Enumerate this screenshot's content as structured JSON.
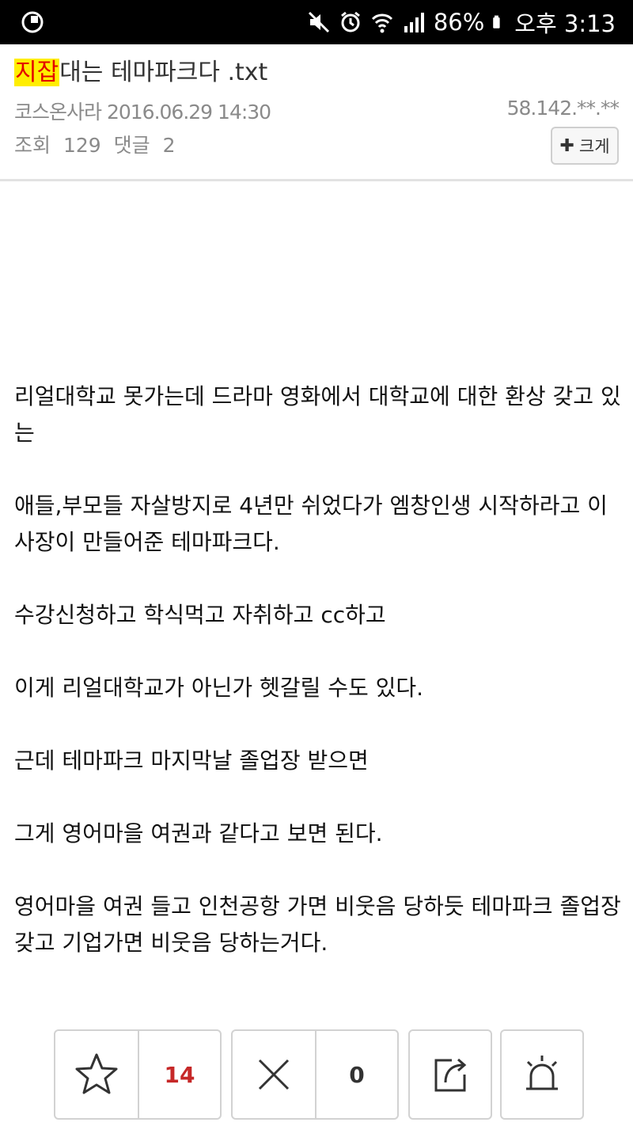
{
  "status_bar": {
    "battery": "86%",
    "time": "오후 3:13"
  },
  "post": {
    "title_highlight": "지잡",
    "title_rest": "대는 테마파크다 .txt",
    "author_date": "코스온사라 2016.06.29 14:30",
    "ip": "58.142.**.**",
    "views_label": "조회",
    "views": "129",
    "comments_label": "댓글",
    "comments": "2",
    "bigger_label": "크게",
    "paragraphs": [
      "리얼대학교 못가는데 드라마 영화에서 대학교에 대한 환상 갖고 있는",
      "애들,부모들 자살방지로 4년만 쉬었다가 엠창인생 시작하라고 이사장이 만들어준 테마파크다.",
      "수강신청하고 학식먹고 자취하고 cc하고",
      "이게 리얼대학교가 아닌가 헷갈릴 수도 있다.",
      "근데 테마파크 마지막날 졸업장 받으면",
      "그게 영어마을 여권과 같다고 보면 된다.",
      "영어마을 여권 들고 인천공항 가면 비웃음 당하듯 테마파크 졸업장 갖고 기업가면 비웃음 당하는거다."
    ]
  },
  "actions": {
    "like_count": "14",
    "dislike_count": "0"
  },
  "icons": {
    "app": "app-icon",
    "mute": "mute-icon",
    "alarm": "alarm-icon",
    "wifi": "wifi-icon",
    "signal": "signal-icon",
    "battery": "battery-icon",
    "like": "star-icon",
    "dislike": "x-icon",
    "share": "share-icon",
    "report": "siren-icon"
  },
  "colors": {
    "highlight_bg": "#ffee00",
    "highlight_text": "#e30000",
    "like_count": "#c62828"
  }
}
